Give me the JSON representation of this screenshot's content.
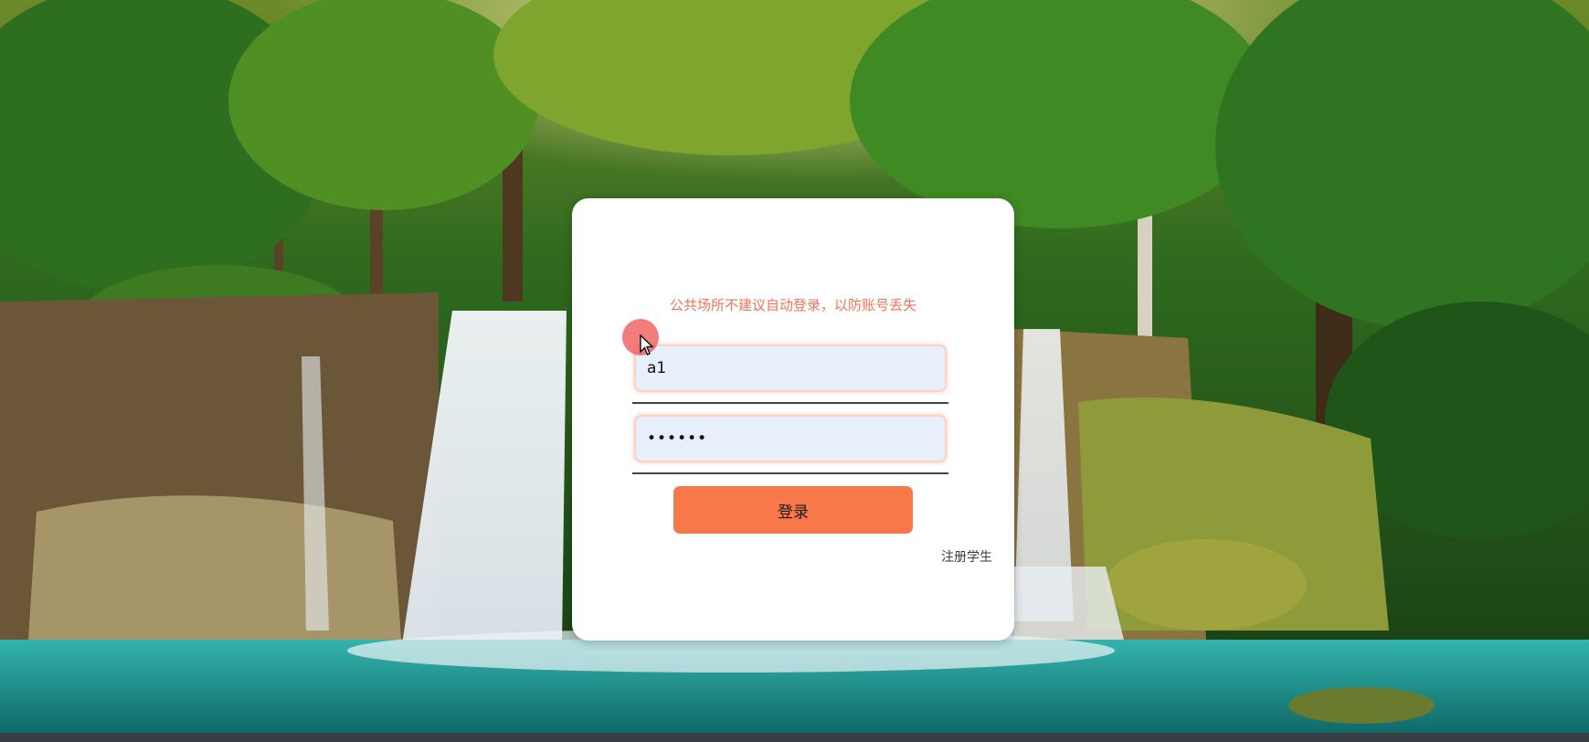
{
  "login": {
    "notice": "公共场所不建议自动登录，以防账号丢失",
    "username_value": "a1",
    "password_value": "••••••",
    "login_label": "登录",
    "register_label": "注册学生"
  },
  "colors": {
    "notice": "#f0735a",
    "button": "#f8784a",
    "field_bg": "#e6effa"
  }
}
